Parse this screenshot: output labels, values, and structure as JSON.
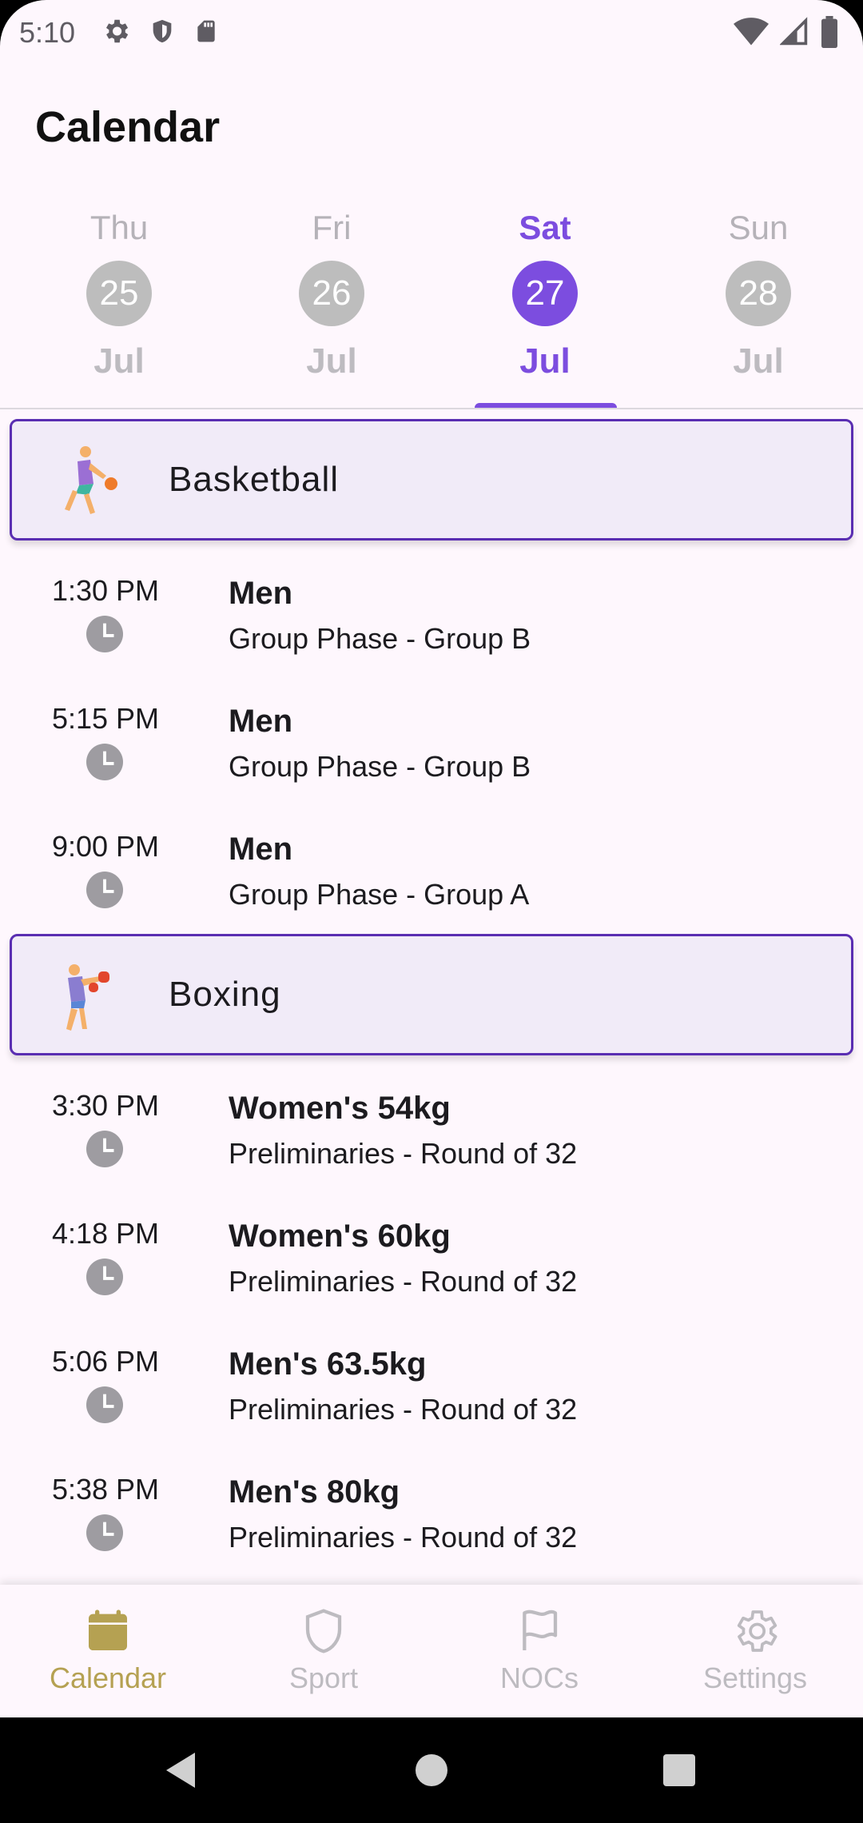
{
  "status_bar": {
    "time": "5:10",
    "left_icons": [
      "gear-icon",
      "shield-icon",
      "sd-card-icon"
    ],
    "right_icons": [
      "wifi-icon",
      "cell-signal-icon",
      "battery-icon"
    ]
  },
  "header": {
    "title": "Calendar"
  },
  "date_tabs": [
    {
      "dow": "Thu",
      "day": "25",
      "month": "Jul",
      "selected": false
    },
    {
      "dow": "Fri",
      "day": "26",
      "month": "Jul",
      "selected": false
    },
    {
      "dow": "Sat",
      "day": "27",
      "month": "Jul",
      "selected": true
    },
    {
      "dow": "Sun",
      "day": "28",
      "month": "Jul",
      "selected": false
    }
  ],
  "sports": [
    {
      "name": "Basketball",
      "icon": "basketball-player-icon",
      "events": [
        {
          "time": "1:30 PM",
          "title": "Men",
          "subtitle": "Group Phase - Group B"
        },
        {
          "time": "5:15 PM",
          "title": "Men",
          "subtitle": "Group Phase - Group B"
        },
        {
          "time": "9:00 PM",
          "title": "Men",
          "subtitle": "Group Phase - Group A"
        }
      ]
    },
    {
      "name": "Boxing",
      "icon": "boxer-icon",
      "events": [
        {
          "time": "3:30 PM",
          "title": "Women's 54kg",
          "subtitle": "Preliminaries - Round of 32"
        },
        {
          "time": "4:18 PM",
          "title": "Women's 60kg",
          "subtitle": "Preliminaries - Round of 32"
        },
        {
          "time": "5:06 PM",
          "title": "Men's 63.5kg",
          "subtitle": "Preliminaries - Round of 32"
        },
        {
          "time": "5:38 PM",
          "title": "Men's 80kg",
          "subtitle": "Preliminaries - Round of 32"
        }
      ]
    }
  ],
  "bottom_nav": {
    "items": [
      {
        "label": "Calendar",
        "icon": "calendar-icon",
        "active": true
      },
      {
        "label": "Sport",
        "icon": "shield-icon",
        "active": false
      },
      {
        "label": "NOCs",
        "icon": "flag-icon",
        "active": false
      },
      {
        "label": "Settings",
        "icon": "gear-icon",
        "active": false
      }
    ]
  },
  "colors": {
    "accent": "#7c4ddf",
    "sport_header_border": "#5a2eb2",
    "sport_header_bg": "#f1ebf8",
    "nav_active": "#b5a152",
    "inactive": "#bdbdbd"
  }
}
